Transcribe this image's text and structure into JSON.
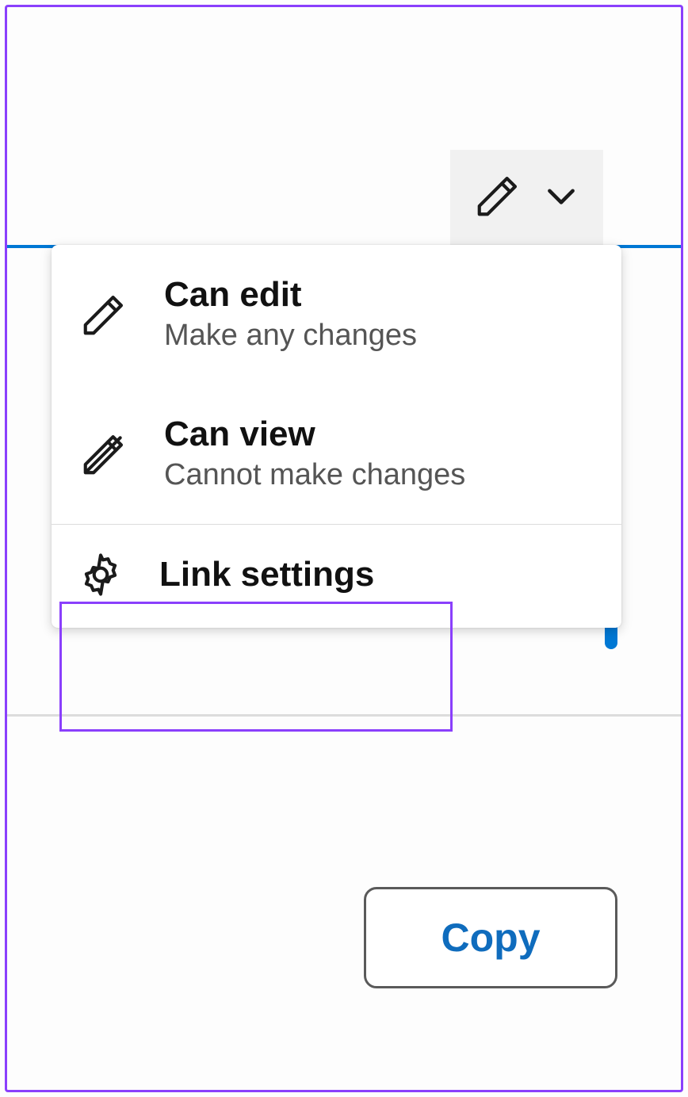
{
  "dropdown": {
    "options": [
      {
        "title": "Can edit",
        "desc": "Make any changes"
      },
      {
        "title": "Can view",
        "desc": "Cannot make changes"
      }
    ],
    "link_settings_label": "Link settings"
  },
  "actions": {
    "copy_label": "Copy"
  },
  "colors": {
    "accent": "#0078d4",
    "highlight": "#8a3ffc"
  }
}
